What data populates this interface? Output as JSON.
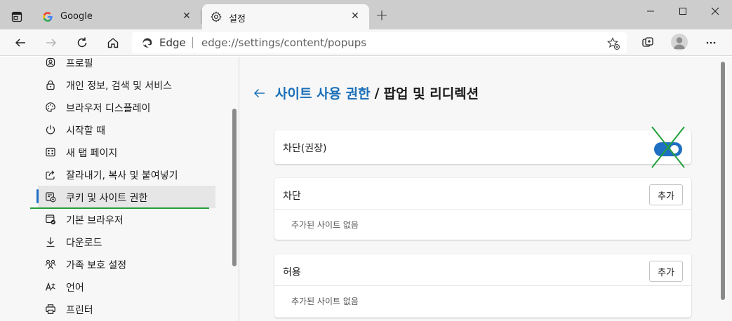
{
  "tabs": [
    {
      "title": "Google",
      "active": false,
      "icon": "google-g-icon"
    },
    {
      "title": "설정",
      "active": true,
      "icon": "gear-icon"
    }
  ],
  "omnibox": {
    "browser_label": "Edge",
    "url": "edge://settings/content/popups"
  },
  "sidebar": {
    "items": [
      {
        "label": "프로필",
        "icon": "profile-icon"
      },
      {
        "label": "개인 정보, 검색 및 서비스",
        "icon": "lock-icon"
      },
      {
        "label": "브라우저 디스플레이",
        "icon": "palette-icon"
      },
      {
        "label": "시작할 때",
        "icon": "power-icon"
      },
      {
        "label": "새 탭 페이지",
        "icon": "new-tab-page-icon"
      },
      {
        "label": "잘라내기, 복사 및 붙여넣기",
        "icon": "share-icon"
      },
      {
        "label": "쿠키 및 사이트 권한",
        "icon": "cookie-site-permissions-icon",
        "selected": true
      },
      {
        "label": "기본 브라우저",
        "icon": "default-browser-icon"
      },
      {
        "label": "다운로드",
        "icon": "download-icon"
      },
      {
        "label": "가족 보호 설정",
        "icon": "family-icon"
      },
      {
        "label": "언어",
        "icon": "language-icon"
      },
      {
        "label": "프린터",
        "icon": "printer-icon"
      }
    ]
  },
  "main": {
    "breadcrumb_link": "사이트 사용 권한",
    "breadcrumb_sep": "/",
    "breadcrumb_current": "팝업 및 리디렉션",
    "block_recommended": {
      "label": "차단(권장)",
      "enabled": true
    },
    "block_section": {
      "title": "차단",
      "add_label": "추가",
      "empty_text": "추가된 사이트 없음"
    },
    "allow_section": {
      "title": "허용",
      "add_label": "추가",
      "empty_text": "추가된 사이트 없음"
    }
  },
  "colors": {
    "accent": "#1f6fc2",
    "annotation_green": "#22a03b"
  }
}
